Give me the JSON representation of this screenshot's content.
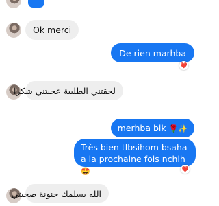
{
  "messages": [
    {
      "side": "in",
      "text": "Ok merci"
    },
    {
      "side": "out",
      "text": "De rien marhba",
      "reaction": "❤️"
    },
    {
      "side": "in",
      "text": "لحقتني الطلبية عجبتني شكرا"
    },
    {
      "side": "out",
      "text": "merhba bik",
      "emoji": "🌹✨"
    },
    {
      "side": "out",
      "text": "Très bien tlbsihom bsaha a la prochaine fois nchlh",
      "emoji": "🤩",
      "reaction": "❤️"
    },
    {
      "side": "in",
      "text": "الله يسلمك حنونة صحيتي"
    }
  ],
  "icons": {
    "reaction": "heart-reaction-icon",
    "avatar": "contact-avatar"
  },
  "colors": {
    "outgoing_bubble": "#1877f2",
    "incoming_bubble": "#eeeeee",
    "reaction_heart": "#e0245e"
  }
}
